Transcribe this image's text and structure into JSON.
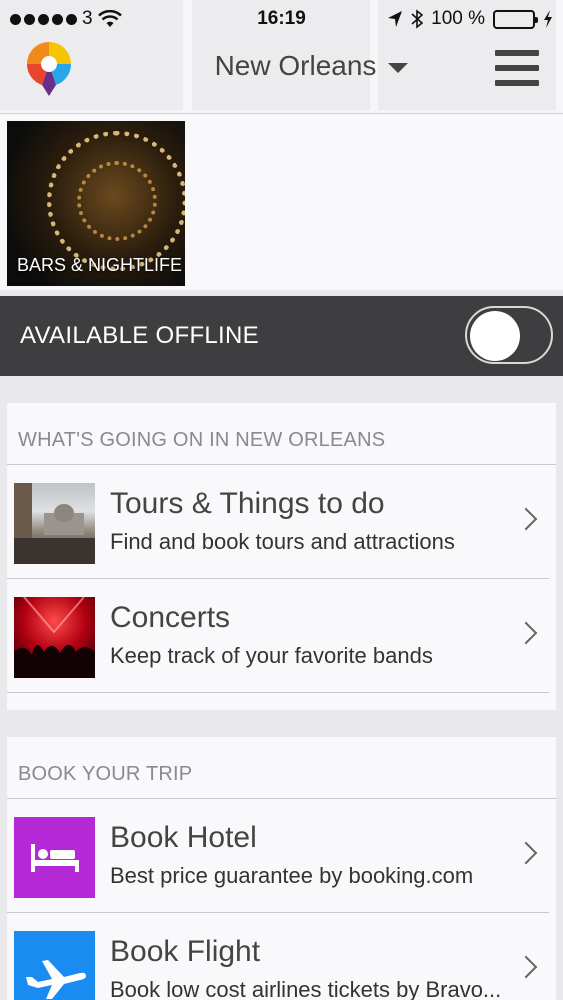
{
  "status_bar": {
    "carrier": "3",
    "time": "16:19",
    "battery": "100 %",
    "battery_color": "#4cd964",
    "icons": [
      "signal-dots-icon",
      "wifi-icon",
      "location-arrow-icon",
      "bluetooth-icon",
      "battery-icon",
      "charging-bolt-icon"
    ]
  },
  "header": {
    "city": "New Orleans",
    "logo_icon": "app-logo-icon",
    "dropdown_icon": "caret-down-icon",
    "menu_icon": "hamburger-menu-icon"
  },
  "categories": [
    {
      "label": "BARS & NIGHTLIFE"
    }
  ],
  "offline": {
    "label": "AVAILABLE OFFLINE",
    "enabled": false
  },
  "whats_going_on": {
    "title": "WHAT'S GOING ON IN NEW ORLEANS",
    "items": [
      {
        "title": "Tours & Things to do",
        "subtitle": "Find and book tours and attractions"
      },
      {
        "title": "Concerts",
        "subtitle": "Keep track of your favorite bands"
      }
    ]
  },
  "book_trip": {
    "title": "BOOK YOUR TRIP",
    "items": [
      {
        "title": "Book Hotel",
        "subtitle": "Best price guarantee by booking.com",
        "icon": "bed-icon",
        "color": "#b428d6"
      },
      {
        "title": "Book Flight",
        "subtitle": "Book low cost airlines tickets by Bravo...",
        "icon": "airplane-icon",
        "color": "#1a8bf0"
      }
    ]
  }
}
